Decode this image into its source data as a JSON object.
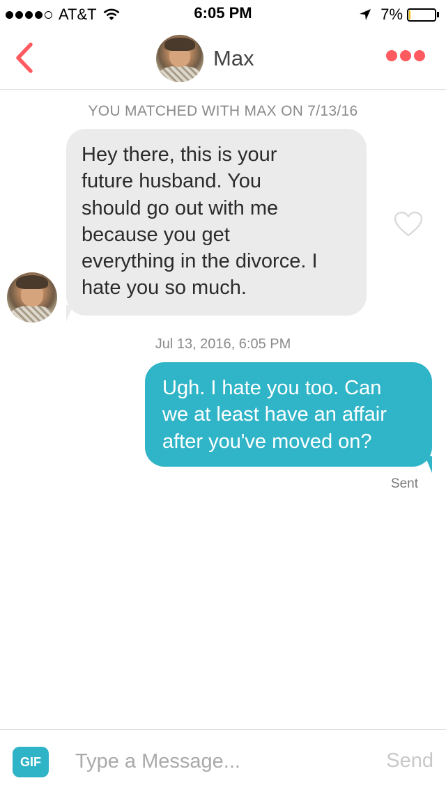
{
  "status_bar": {
    "carrier": "AT&T",
    "time": "6:05 PM",
    "battery_percent": "7%",
    "battery_level": 0.07,
    "signal_bars": 4,
    "icons": [
      "signal-dots",
      "wifi-icon",
      "location-arrow-icon",
      "battery-icon"
    ]
  },
  "header": {
    "contact_name": "Max",
    "back_icon": "chevron-left-icon",
    "more_icon": "more-dots-icon",
    "accent_color": "#ff5a5f"
  },
  "conversation": {
    "match_notice": "YOU MATCHED WITH MAX ON 7/13/16",
    "incoming": {
      "lines": [
        "Hey there, this is your",
        "future husband. You",
        "should go out with me",
        "because you get",
        "everything in the divorce. I",
        "hate you so much."
      ],
      "bubble_color": "#ebebeb"
    },
    "timestamp": "Jul 13, 2016, 6:05 PM",
    "outgoing": {
      "lines": [
        "Ugh. I hate you too. Can",
        "we at least have an affair",
        "after you've moved on?"
      ],
      "status": "Sent",
      "bubble_color": "#30b4c7"
    }
  },
  "composer": {
    "gif_label": "GIF",
    "placeholder": "Type a Message...",
    "value": "",
    "send_label": "Send"
  }
}
